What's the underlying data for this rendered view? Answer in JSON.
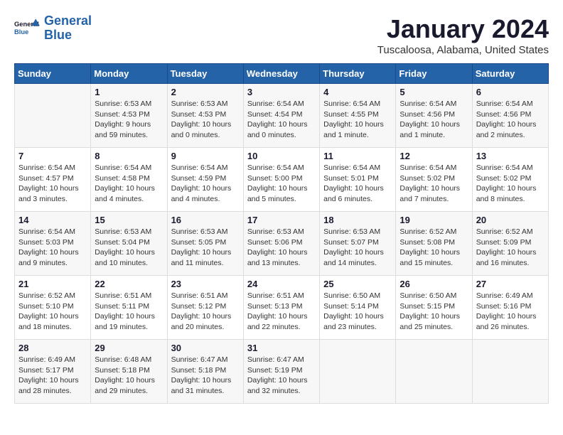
{
  "header": {
    "logo_line1": "General",
    "logo_line2": "Blue",
    "month": "January 2024",
    "location": "Tuscaloosa, Alabama, United States"
  },
  "days_of_week": [
    "Sunday",
    "Monday",
    "Tuesday",
    "Wednesday",
    "Thursday",
    "Friday",
    "Saturday"
  ],
  "weeks": [
    [
      {
        "num": "",
        "info": ""
      },
      {
        "num": "1",
        "info": "Sunrise: 6:53 AM\nSunset: 4:53 PM\nDaylight: 9 hours\nand 59 minutes."
      },
      {
        "num": "2",
        "info": "Sunrise: 6:53 AM\nSunset: 4:53 PM\nDaylight: 10 hours\nand 0 minutes."
      },
      {
        "num": "3",
        "info": "Sunrise: 6:54 AM\nSunset: 4:54 PM\nDaylight: 10 hours\nand 0 minutes."
      },
      {
        "num": "4",
        "info": "Sunrise: 6:54 AM\nSunset: 4:55 PM\nDaylight: 10 hours\nand 1 minute."
      },
      {
        "num": "5",
        "info": "Sunrise: 6:54 AM\nSunset: 4:56 PM\nDaylight: 10 hours\nand 1 minute."
      },
      {
        "num": "6",
        "info": "Sunrise: 6:54 AM\nSunset: 4:56 PM\nDaylight: 10 hours\nand 2 minutes."
      }
    ],
    [
      {
        "num": "7",
        "info": "Sunrise: 6:54 AM\nSunset: 4:57 PM\nDaylight: 10 hours\nand 3 minutes."
      },
      {
        "num": "8",
        "info": "Sunrise: 6:54 AM\nSunset: 4:58 PM\nDaylight: 10 hours\nand 4 minutes."
      },
      {
        "num": "9",
        "info": "Sunrise: 6:54 AM\nSunset: 4:59 PM\nDaylight: 10 hours\nand 4 minutes."
      },
      {
        "num": "10",
        "info": "Sunrise: 6:54 AM\nSunset: 5:00 PM\nDaylight: 10 hours\nand 5 minutes."
      },
      {
        "num": "11",
        "info": "Sunrise: 6:54 AM\nSunset: 5:01 PM\nDaylight: 10 hours\nand 6 minutes."
      },
      {
        "num": "12",
        "info": "Sunrise: 6:54 AM\nSunset: 5:02 PM\nDaylight: 10 hours\nand 7 minutes."
      },
      {
        "num": "13",
        "info": "Sunrise: 6:54 AM\nSunset: 5:02 PM\nDaylight: 10 hours\nand 8 minutes."
      }
    ],
    [
      {
        "num": "14",
        "info": "Sunrise: 6:54 AM\nSunset: 5:03 PM\nDaylight: 10 hours\nand 9 minutes."
      },
      {
        "num": "15",
        "info": "Sunrise: 6:53 AM\nSunset: 5:04 PM\nDaylight: 10 hours\nand 10 minutes."
      },
      {
        "num": "16",
        "info": "Sunrise: 6:53 AM\nSunset: 5:05 PM\nDaylight: 10 hours\nand 11 minutes."
      },
      {
        "num": "17",
        "info": "Sunrise: 6:53 AM\nSunset: 5:06 PM\nDaylight: 10 hours\nand 13 minutes."
      },
      {
        "num": "18",
        "info": "Sunrise: 6:53 AM\nSunset: 5:07 PM\nDaylight: 10 hours\nand 14 minutes."
      },
      {
        "num": "19",
        "info": "Sunrise: 6:52 AM\nSunset: 5:08 PM\nDaylight: 10 hours\nand 15 minutes."
      },
      {
        "num": "20",
        "info": "Sunrise: 6:52 AM\nSunset: 5:09 PM\nDaylight: 10 hours\nand 16 minutes."
      }
    ],
    [
      {
        "num": "21",
        "info": "Sunrise: 6:52 AM\nSunset: 5:10 PM\nDaylight: 10 hours\nand 18 minutes."
      },
      {
        "num": "22",
        "info": "Sunrise: 6:51 AM\nSunset: 5:11 PM\nDaylight: 10 hours\nand 19 minutes."
      },
      {
        "num": "23",
        "info": "Sunrise: 6:51 AM\nSunset: 5:12 PM\nDaylight: 10 hours\nand 20 minutes."
      },
      {
        "num": "24",
        "info": "Sunrise: 6:51 AM\nSunset: 5:13 PM\nDaylight: 10 hours\nand 22 minutes."
      },
      {
        "num": "25",
        "info": "Sunrise: 6:50 AM\nSunset: 5:14 PM\nDaylight: 10 hours\nand 23 minutes."
      },
      {
        "num": "26",
        "info": "Sunrise: 6:50 AM\nSunset: 5:15 PM\nDaylight: 10 hours\nand 25 minutes."
      },
      {
        "num": "27",
        "info": "Sunrise: 6:49 AM\nSunset: 5:16 PM\nDaylight: 10 hours\nand 26 minutes."
      }
    ],
    [
      {
        "num": "28",
        "info": "Sunrise: 6:49 AM\nSunset: 5:17 PM\nDaylight: 10 hours\nand 28 minutes."
      },
      {
        "num": "29",
        "info": "Sunrise: 6:48 AM\nSunset: 5:18 PM\nDaylight: 10 hours\nand 29 minutes."
      },
      {
        "num": "30",
        "info": "Sunrise: 6:47 AM\nSunset: 5:18 PM\nDaylight: 10 hours\nand 31 minutes."
      },
      {
        "num": "31",
        "info": "Sunrise: 6:47 AM\nSunset: 5:19 PM\nDaylight: 10 hours\nand 32 minutes."
      },
      {
        "num": "",
        "info": ""
      },
      {
        "num": "",
        "info": ""
      },
      {
        "num": "",
        "info": ""
      }
    ]
  ]
}
